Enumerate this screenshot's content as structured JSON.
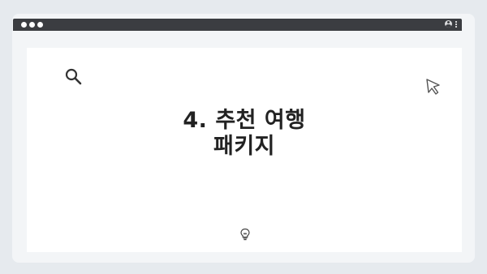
{
  "window": {
    "title_dots": [
      "dot",
      "dot",
      "dot"
    ],
    "controls": [
      "close",
      "minimize",
      "maximize"
    ]
  },
  "titlebar": {
    "icons": [
      "profile-icon",
      "more-menu-icon"
    ]
  },
  "main": {
    "heading_line1": "4. 추천 여행",
    "heading_line2": "패키지",
    "icons": [
      "search-icon",
      "cursor-icon",
      "lightbulb-icon"
    ]
  },
  "colors": {
    "background": "#e6eaee",
    "window": "#f3f5f7",
    "titlebar": "#3b3d41",
    "content": "#ffffff",
    "heading": "#222222"
  }
}
